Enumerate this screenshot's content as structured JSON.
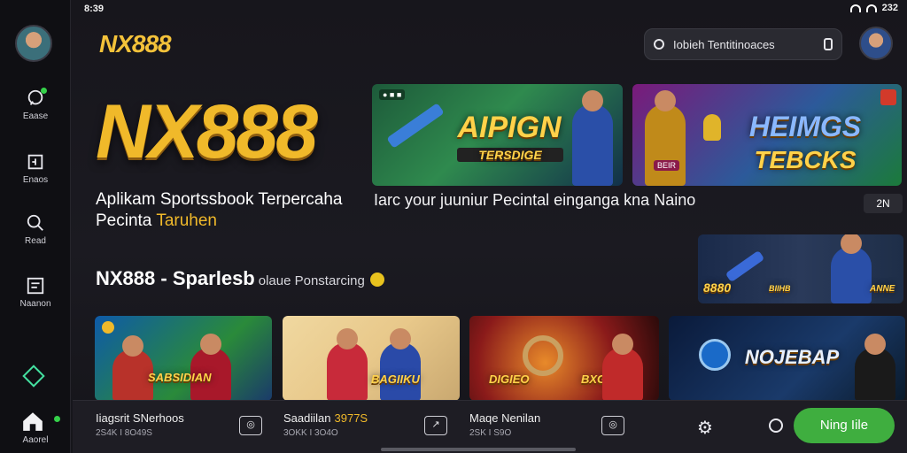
{
  "status": {
    "time": "8:39",
    "battery": "232"
  },
  "sidebar": {
    "items": [
      {
        "label": "Eaase",
        "icon": "chat-icon"
      },
      {
        "label": "Enaos",
        "icon": "grid-icon"
      },
      {
        "label": "Read",
        "icon": "search-icon"
      },
      {
        "label": "Naanon",
        "icon": "list-icon"
      },
      {
        "label": "Aaorel",
        "icon": "home-icon"
      }
    ]
  },
  "header": {
    "logo": "NX888",
    "search_placeholder": "Iobieh Tentitinoaces"
  },
  "hero": {
    "logo": "NX888",
    "tagline_1": "Aplikam Sportssbook Terpercaha",
    "tagline_2": "Pecinta",
    "tagline_gold": "Taruhen",
    "caption": "Iarc your juuniur Pecintal einganga kna Naino",
    "page_count": "2N",
    "banners": [
      {
        "title_1": "AIPIGN",
        "title_2": "TERSDIGE"
      },
      {
        "title_1": "HEIMGS",
        "title_2": "TEBCKS",
        "badge": "BEIR"
      }
    ],
    "side_card": {
      "left": "8880",
      "middle": "BIIHB",
      "right": "ANNE"
    }
  },
  "section": {
    "title": "NX888 - Sparlesb",
    "subtitle": "olaue Ponstarcing"
  },
  "cards": [
    {
      "title": "SABSIDIAN"
    },
    {
      "title": "BAGIIKU"
    },
    {
      "title_left": "DIGIEO",
      "title_right": "BXGBIM"
    },
    {
      "title": "NOJEBAP"
    }
  ],
  "bottombar": {
    "items": [
      {
        "title": "Iiagsrit SNerhoos",
        "sub": "2S4K I 8O49S"
      },
      {
        "title": "Saadiilan",
        "price": "3977S",
        "sub": "3OKK I 3O4O"
      },
      {
        "title": "Maqe Nenilan",
        "sub": "2SK I S9O"
      }
    ],
    "cta": "Ning Iile"
  },
  "colors": {
    "accent_gold": "#f0b92a",
    "cta_green": "#3fae3f"
  }
}
